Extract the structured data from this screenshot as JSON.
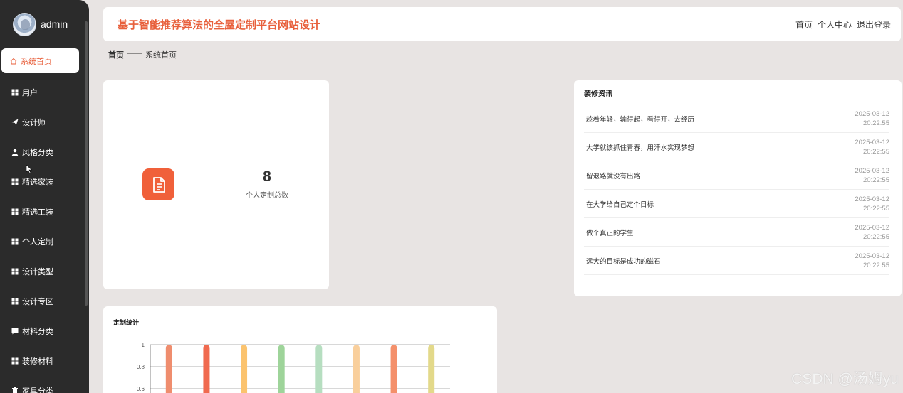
{
  "profile": {
    "name": "admin"
  },
  "sidebar": {
    "items": [
      {
        "label": "系统首页",
        "icon": "home-icon"
      },
      {
        "label": "用户",
        "icon": "grid-icon"
      },
      {
        "label": "设计师",
        "icon": "send-icon"
      },
      {
        "label": "风格分类",
        "icon": "user-icon"
      },
      {
        "label": "精选家装",
        "icon": "grid-icon"
      },
      {
        "label": "精选工装",
        "icon": "grid-icon"
      },
      {
        "label": "个人定制",
        "icon": "grid-icon"
      },
      {
        "label": "设计类型",
        "icon": "grid-icon"
      },
      {
        "label": "设计专区",
        "icon": "grid-icon"
      },
      {
        "label": "材料分类",
        "icon": "comment-icon"
      },
      {
        "label": "装修材料",
        "icon": "grid-icon"
      },
      {
        "label": "家具分类",
        "icon": "trash-icon"
      }
    ]
  },
  "header": {
    "title": "基于智能推荐算法的全屋定制平台网站设计",
    "links": [
      "首页",
      "个人中心",
      "退出登录"
    ]
  },
  "breadcrumb": {
    "home": "首页",
    "separator": "——",
    "current": "系统首页"
  },
  "count_card": {
    "value": "8",
    "label": "个人定制总数",
    "icon": "document-icon",
    "color": "#f0603a"
  },
  "news": {
    "title": "装修资讯",
    "items": [
      {
        "text": "趁着年轻，输得起，看得开，去经历",
        "date": "2025-03-12",
        "time": "20:22:55"
      },
      {
        "text": "大学就该抓住青春，用汗水实现梦想",
        "date": "2025-03-12",
        "time": "20:22:55"
      },
      {
        "text": "留退路就没有出路",
        "date": "2025-03-12",
        "time": "20:22:55"
      },
      {
        "text": "在大学给自己定个目标",
        "date": "2025-03-12",
        "time": "20:22:55"
      },
      {
        "text": "做个真正的学生",
        "date": "2025-03-12",
        "time": "20:22:55"
      },
      {
        "text": "远大的目标是成功的磁石",
        "date": "2025-03-12",
        "time": "20:22:55"
      }
    ]
  },
  "chart_title": "定制统计",
  "chart_data": {
    "type": "bar",
    "title": "定制统计",
    "y_ticks": [
      "1",
      "0.8",
      "0.6"
    ],
    "ylim": [
      0,
      1
    ],
    "values": [
      1,
      1,
      1,
      1,
      1,
      1,
      1,
      1
    ],
    "colors": [
      "#ef8d6e",
      "#f06a4f",
      "#fbc36e",
      "#9ed49a",
      "#b6dec0",
      "#f9cf9c",
      "#f4906b",
      "#e3d98a"
    ],
    "grid": true
  },
  "watermark": "CSDN @汤姆yu",
  "colors": {
    "accent": "#e8603c",
    "sidebar": "#2b2b2b",
    "background": "#e8e4e3"
  }
}
